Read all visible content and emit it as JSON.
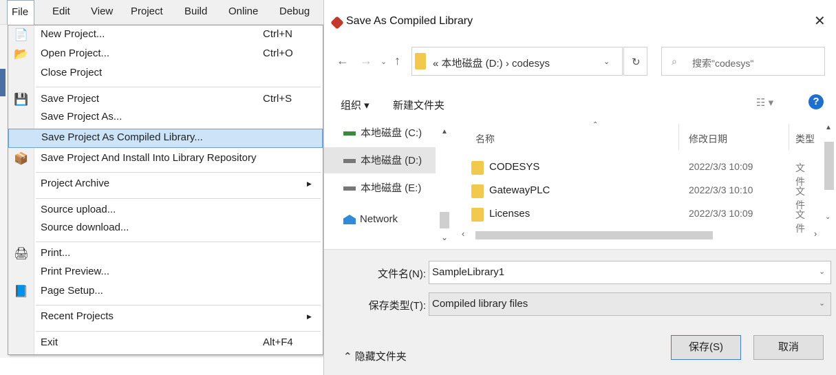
{
  "menubar": {
    "items": [
      "File",
      "Edit",
      "View",
      "Project",
      "Build",
      "Online",
      "Debug"
    ]
  },
  "file_menu": {
    "items": [
      {
        "label": "New Project...",
        "shortcut": "Ctrl+N",
        "icon": "new-project-icon"
      },
      {
        "label": "Open Project...",
        "shortcut": "Ctrl+O",
        "icon": "open-folder-icon"
      },
      {
        "label": "Close Project"
      },
      {
        "label": "Save Project",
        "shortcut": "Ctrl+S",
        "icon": "floppy-disk-icon"
      },
      {
        "label": "Save Project As..."
      },
      {
        "label": "Save Project As Compiled Library...",
        "highlighted": true
      },
      {
        "label": "Save Project And Install Into Library Repository",
        "icon": "library-install-icon"
      },
      {
        "label": "Project Archive",
        "submenu": true
      },
      {
        "label": "Source upload..."
      },
      {
        "label": "Source download..."
      },
      {
        "label": "Print...",
        "icon": "printer-icon"
      },
      {
        "label": "Print Preview..."
      },
      {
        "label": "Page Setup...",
        "icon": "page-setup-icon"
      },
      {
        "label": "Recent Projects",
        "submenu": true
      },
      {
        "label": "Exit",
        "shortcut": "Alt+F4"
      }
    ]
  },
  "dialog": {
    "title": "Save As Compiled Library",
    "address_path": "« 本地磁盘 (D:)  ›  codesys",
    "search_placeholder": "搜索\"codesys\"",
    "toolbar": {
      "organize": "组织 ▾",
      "new_folder": "新建文件夹"
    },
    "nav_items": [
      {
        "label": "本地磁盘 (C:)"
      },
      {
        "label": "本地磁盘 (D:)",
        "selected": true
      },
      {
        "label": "本地磁盘 (E:)"
      },
      {
        "label": "Network"
      }
    ],
    "columns": {
      "name": "名称",
      "date": "修改日期",
      "type": "类型"
    },
    "files": [
      {
        "name": "CODESYS",
        "date": "2022/3/3 10:09",
        "type": "文件"
      },
      {
        "name": "GatewayPLC",
        "date": "2022/3/3 10:10",
        "type": "文件"
      },
      {
        "name": "Licenses",
        "date": "2022/3/3 10:09",
        "type": "文件"
      }
    ],
    "filename_label": "文件名(N):",
    "filename_value": "SampleLibrary1",
    "filetype_label": "保存类型(T):",
    "filetype_value": "Compiled library files",
    "hide_folders": "隐藏文件夹",
    "save_button": "保存(S)",
    "cancel_button": "取消",
    "accent_color": "#3c7fd0"
  }
}
